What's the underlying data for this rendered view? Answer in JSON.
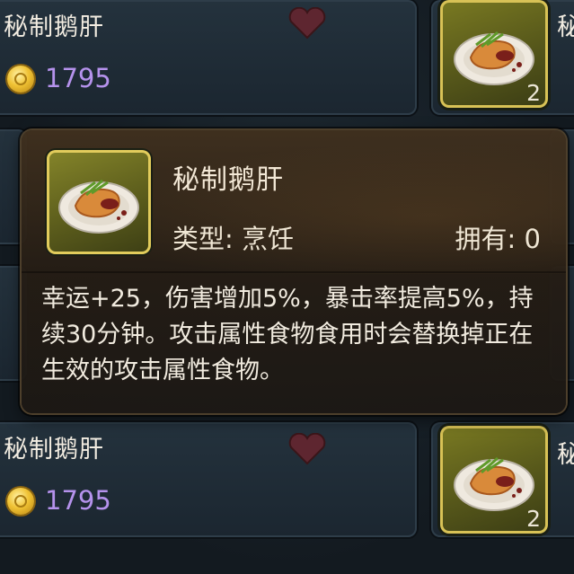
{
  "items": [
    {
      "name": "秘制鹅肝",
      "price": "1795"
    },
    {
      "name": "秘制鹅肝",
      "price": "1795"
    }
  ],
  "side_name_partial": "秘",
  "slots": [
    {
      "qty": "2"
    },
    {
      "qty": "2"
    }
  ],
  "tooltip": {
    "title": "秘制鹅肝",
    "type_label": "类型: 烹饪",
    "owned_label": "拥有: 0",
    "description": "幸运+25，伤害增加5%，暴击率提高5%，持续30分钟。攻击属性食物食用时会替换掉正在生效的攻击属性食物。"
  },
  "colors": {
    "price": "#b592ec",
    "slot_border": "#d8c256",
    "heart": "#6b2b34"
  },
  "icons": {
    "currency": "gold-coin-icon",
    "favorite": "heart-icon",
    "item": "foie-gras-dish-icon"
  }
}
